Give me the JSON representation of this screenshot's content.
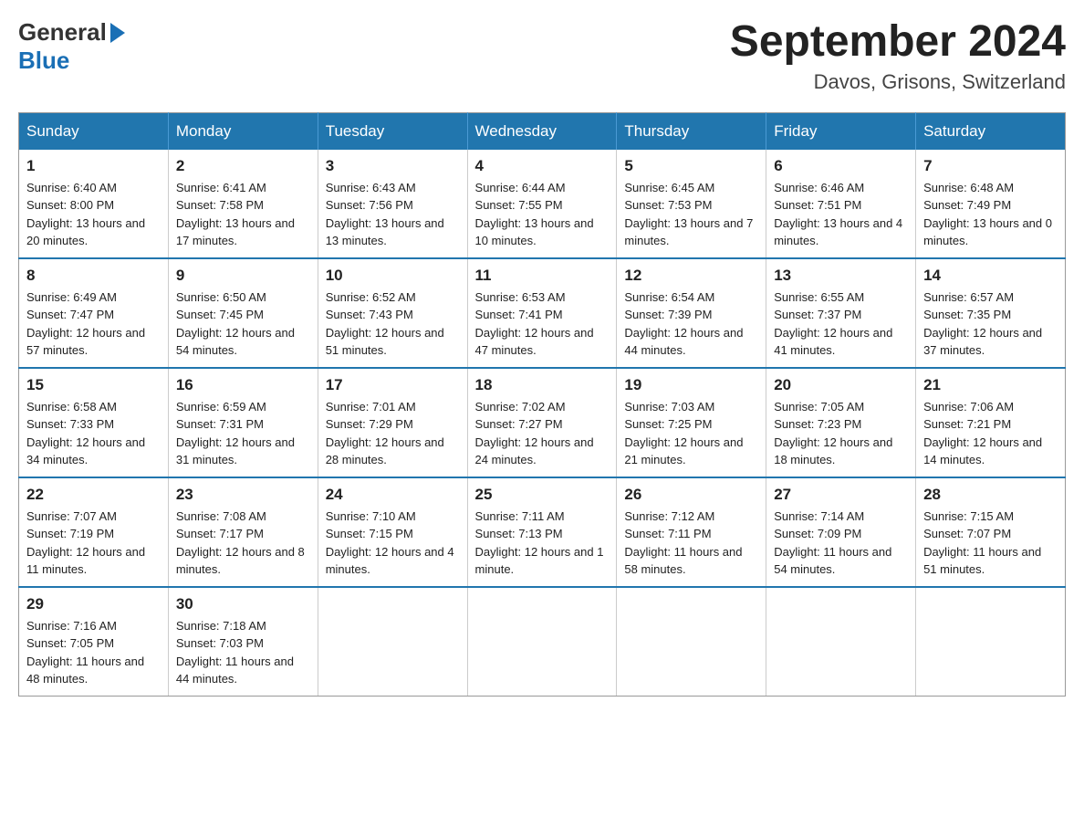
{
  "logo": {
    "general": "General",
    "blue": "Blue"
  },
  "title": {
    "month_year": "September 2024",
    "location": "Davos, Grisons, Switzerland"
  },
  "headers": [
    "Sunday",
    "Monday",
    "Tuesday",
    "Wednesday",
    "Thursday",
    "Friday",
    "Saturday"
  ],
  "weeks": [
    [
      {
        "day": "1",
        "sunrise": "6:40 AM",
        "sunset": "8:00 PM",
        "daylight": "13 hours and 20 minutes."
      },
      {
        "day": "2",
        "sunrise": "6:41 AM",
        "sunset": "7:58 PM",
        "daylight": "13 hours and 17 minutes."
      },
      {
        "day": "3",
        "sunrise": "6:43 AM",
        "sunset": "7:56 PM",
        "daylight": "13 hours and 13 minutes."
      },
      {
        "day": "4",
        "sunrise": "6:44 AM",
        "sunset": "7:55 PM",
        "daylight": "13 hours and 10 minutes."
      },
      {
        "day": "5",
        "sunrise": "6:45 AM",
        "sunset": "7:53 PM",
        "daylight": "13 hours and 7 minutes."
      },
      {
        "day": "6",
        "sunrise": "6:46 AM",
        "sunset": "7:51 PM",
        "daylight": "13 hours and 4 minutes."
      },
      {
        "day": "7",
        "sunrise": "6:48 AM",
        "sunset": "7:49 PM",
        "daylight": "13 hours and 0 minutes."
      }
    ],
    [
      {
        "day": "8",
        "sunrise": "6:49 AM",
        "sunset": "7:47 PM",
        "daylight": "12 hours and 57 minutes."
      },
      {
        "day": "9",
        "sunrise": "6:50 AM",
        "sunset": "7:45 PM",
        "daylight": "12 hours and 54 minutes."
      },
      {
        "day": "10",
        "sunrise": "6:52 AM",
        "sunset": "7:43 PM",
        "daylight": "12 hours and 51 minutes."
      },
      {
        "day": "11",
        "sunrise": "6:53 AM",
        "sunset": "7:41 PM",
        "daylight": "12 hours and 47 minutes."
      },
      {
        "day": "12",
        "sunrise": "6:54 AM",
        "sunset": "7:39 PM",
        "daylight": "12 hours and 44 minutes."
      },
      {
        "day": "13",
        "sunrise": "6:55 AM",
        "sunset": "7:37 PM",
        "daylight": "12 hours and 41 minutes."
      },
      {
        "day": "14",
        "sunrise": "6:57 AM",
        "sunset": "7:35 PM",
        "daylight": "12 hours and 37 minutes."
      }
    ],
    [
      {
        "day": "15",
        "sunrise": "6:58 AM",
        "sunset": "7:33 PM",
        "daylight": "12 hours and 34 minutes."
      },
      {
        "day": "16",
        "sunrise": "6:59 AM",
        "sunset": "7:31 PM",
        "daylight": "12 hours and 31 minutes."
      },
      {
        "day": "17",
        "sunrise": "7:01 AM",
        "sunset": "7:29 PM",
        "daylight": "12 hours and 28 minutes."
      },
      {
        "day": "18",
        "sunrise": "7:02 AM",
        "sunset": "7:27 PM",
        "daylight": "12 hours and 24 minutes."
      },
      {
        "day": "19",
        "sunrise": "7:03 AM",
        "sunset": "7:25 PM",
        "daylight": "12 hours and 21 minutes."
      },
      {
        "day": "20",
        "sunrise": "7:05 AM",
        "sunset": "7:23 PM",
        "daylight": "12 hours and 18 minutes."
      },
      {
        "day": "21",
        "sunrise": "7:06 AM",
        "sunset": "7:21 PM",
        "daylight": "12 hours and 14 minutes."
      }
    ],
    [
      {
        "day": "22",
        "sunrise": "7:07 AM",
        "sunset": "7:19 PM",
        "daylight": "12 hours and 11 minutes."
      },
      {
        "day": "23",
        "sunrise": "7:08 AM",
        "sunset": "7:17 PM",
        "daylight": "12 hours and 8 minutes."
      },
      {
        "day": "24",
        "sunrise": "7:10 AM",
        "sunset": "7:15 PM",
        "daylight": "12 hours and 4 minutes."
      },
      {
        "day": "25",
        "sunrise": "7:11 AM",
        "sunset": "7:13 PM",
        "daylight": "12 hours and 1 minute."
      },
      {
        "day": "26",
        "sunrise": "7:12 AM",
        "sunset": "7:11 PM",
        "daylight": "11 hours and 58 minutes."
      },
      {
        "day": "27",
        "sunrise": "7:14 AM",
        "sunset": "7:09 PM",
        "daylight": "11 hours and 54 minutes."
      },
      {
        "day": "28",
        "sunrise": "7:15 AM",
        "sunset": "7:07 PM",
        "daylight": "11 hours and 51 minutes."
      }
    ],
    [
      {
        "day": "29",
        "sunrise": "7:16 AM",
        "sunset": "7:05 PM",
        "daylight": "11 hours and 48 minutes."
      },
      {
        "day": "30",
        "sunrise": "7:18 AM",
        "sunset": "7:03 PM",
        "daylight": "11 hours and 44 minutes."
      },
      null,
      null,
      null,
      null,
      null
    ]
  ]
}
